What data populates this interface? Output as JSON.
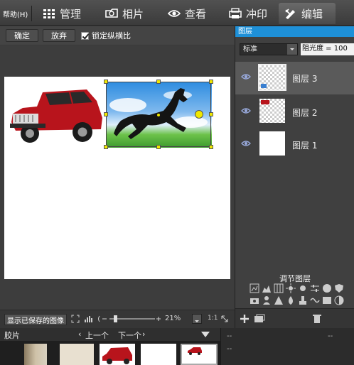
{
  "topbar": {
    "help_label": "帮助(H)",
    "tabs": [
      {
        "label": "管理",
        "icon": "grid-icon"
      },
      {
        "label": "相片",
        "icon": "photo-tag-icon"
      },
      {
        "label": "查看",
        "icon": "eye-icon"
      },
      {
        "label": "冲印",
        "icon": "printer-icon"
      },
      {
        "label": "编辑",
        "icon": "edit-icon"
      }
    ]
  },
  "toolbar": {
    "confirm_label": "确定",
    "discard_label": "放弃",
    "lock_ratio_label": "锁定纵横比"
  },
  "layers_panel": {
    "title": "图层",
    "blend_mode": "标准",
    "opacity_text": "阻光度 = 100",
    "layers": [
      {
        "name": "图层 3"
      },
      {
        "name": "图层 2"
      },
      {
        "name": "图层 1"
      }
    ],
    "adjust_title": "调节图层"
  },
  "status": {
    "show_saved_label": "显示已保存的图像",
    "zoom": "21%",
    "ratio": "1:1"
  },
  "filmstrip": {
    "title": "胶片",
    "prev_label": "上一个",
    "next_label": "下一个"
  },
  "footer": {
    "cell1": "--",
    "cell2": "--",
    "cell3": "--"
  },
  "colors": {
    "accent": "#1e90d8",
    "handle": "#f0e800"
  }
}
